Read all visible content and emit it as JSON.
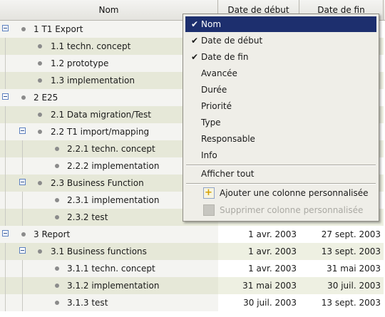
{
  "columns": {
    "name": "Nom",
    "start": "Date de début",
    "end": "Date de fin"
  },
  "rows": [
    {
      "label": "1 T1 Export",
      "toggle": true,
      "start": "",
      "end": ""
    },
    {
      "label": "1.1 techn. concept",
      "toggle": false,
      "start": "",
      "end": ""
    },
    {
      "label": "1.2 prototype",
      "toggle": false,
      "start": "",
      "end": ""
    },
    {
      "label": "1.3 implementation",
      "toggle": false,
      "start": "",
      "end": ""
    },
    {
      "label": "2 E25",
      "toggle": true,
      "start": "",
      "end": ""
    },
    {
      "label": "2.1 Data migration/Test",
      "toggle": false,
      "start": "",
      "end": ""
    },
    {
      "label": "2.2 T1 import/mapping",
      "toggle": true,
      "start": "",
      "end": ""
    },
    {
      "label": "2.2.1 techn. concept",
      "toggle": false,
      "start": "",
      "end": ""
    },
    {
      "label": "2.2.2 implementation",
      "toggle": false,
      "start": "",
      "end": ""
    },
    {
      "label": "2.3 Business Function",
      "toggle": true,
      "start": "",
      "end": ""
    },
    {
      "label": "2.3.1 implementation",
      "toggle": false,
      "start": "",
      "end": ""
    },
    {
      "label": "2.3.2 test",
      "toggle": false,
      "start": "",
      "end": ""
    },
    {
      "label": "3 Report",
      "toggle": true,
      "start": "1 avr. 2003",
      "end": "27 sept. 2003"
    },
    {
      "label": "3.1 Business functions",
      "toggle": true,
      "start": "1 avr. 2003",
      "end": "13 sept. 2003"
    },
    {
      "label": "3.1.1 techn. concept",
      "toggle": false,
      "start": "1 avr. 2003",
      "end": "31 mai 2003"
    },
    {
      "label": "3.1.2 implementation",
      "toggle": false,
      "start": "31 mai 2003",
      "end": "30 juil. 2003"
    },
    {
      "label": "3.1.3 test",
      "toggle": false,
      "start": "30 juil. 2003",
      "end": "13 sept. 2003"
    }
  ],
  "menu": {
    "columns": [
      {
        "label": "Nom",
        "checked": true
      },
      {
        "label": "Date de début",
        "checked": true
      },
      {
        "label": "Date de fin",
        "checked": true
      },
      {
        "label": "Avancée",
        "checked": false
      },
      {
        "label": "Durée",
        "checked": false
      },
      {
        "label": "Priorité",
        "checked": false
      },
      {
        "label": "Type",
        "checked": false
      },
      {
        "label": "Responsable",
        "checked": false
      },
      {
        "label": "Info",
        "checked": false
      }
    ],
    "show_all": "Afficher tout",
    "add_custom": "Ajouter une colonne personnalisée",
    "remove_custom": "Supprimer colonne personnalisée",
    "check_glyph": "✔"
  }
}
